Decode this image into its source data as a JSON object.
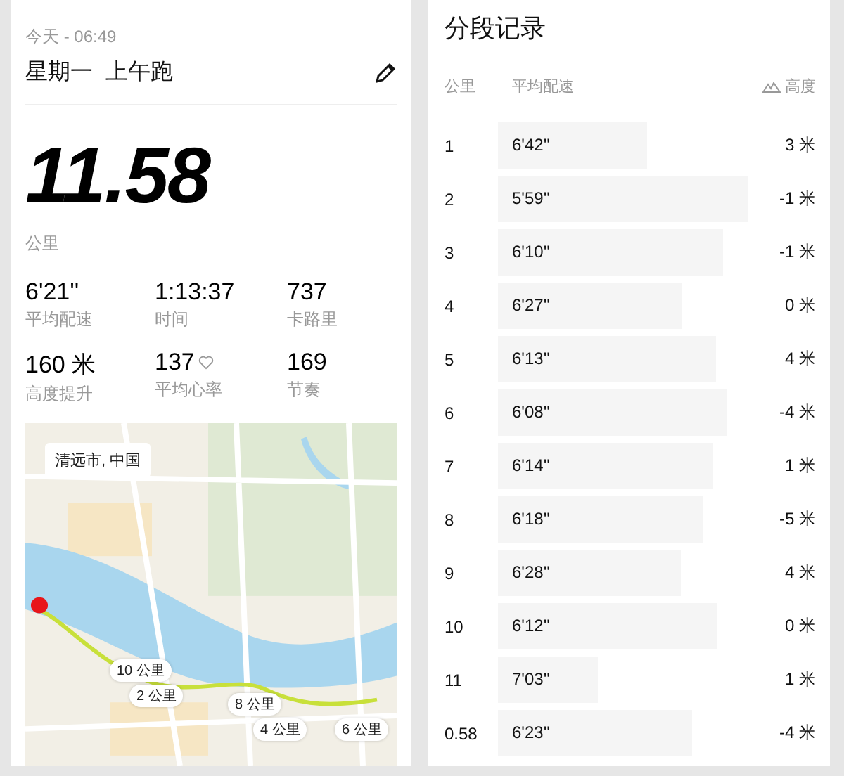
{
  "activity": {
    "date_time": "今天 - 06:49",
    "title": "星期一  上午跑",
    "distance": "11.58",
    "distance_unit": "公里",
    "stats": [
      {
        "kind": "plain",
        "value": "6'21''",
        "label": "平均配速"
      },
      {
        "kind": "plain",
        "value": "1:13:37",
        "label": "时间"
      },
      {
        "kind": "plain",
        "value": "737",
        "label": "卡路里"
      },
      {
        "kind": "plain",
        "value": "160 米",
        "label": "高度提升"
      },
      {
        "kind": "heart_rate",
        "value": "137",
        "label": "平均心率"
      },
      {
        "kind": "plain",
        "value": "169",
        "label": "节奏"
      }
    ],
    "map": {
      "location": "清远市, 中国",
      "markers": [
        "10 公里",
        "2 公里",
        "8 公里",
        "4 公里",
        "6 公里"
      ]
    }
  },
  "splits": {
    "title": "分段记录",
    "columns": [
      "公里",
      "平均配速",
      "高度"
    ],
    "rows": [
      {
        "km": "1",
        "pace": "6'42''",
        "elevation": "3 米"
      },
      {
        "km": "2",
        "pace": "5'59''",
        "elevation": "-1 米"
      },
      {
        "km": "3",
        "pace": "6'10''",
        "elevation": "-1 米"
      },
      {
        "km": "4",
        "pace": "6'27''",
        "elevation": "0 米"
      },
      {
        "km": "5",
        "pace": "6'13''",
        "elevation": "4 米"
      },
      {
        "km": "6",
        "pace": "6'08''",
        "elevation": "-4 米"
      },
      {
        "km": "7",
        "pace": "6'14''",
        "elevation": "1 米"
      },
      {
        "km": "8",
        "pace": "6'18''",
        "elevation": "-5 米"
      },
      {
        "km": "9",
        "pace": "6'28''",
        "elevation": "4 米"
      },
      {
        "km": "10",
        "pace": "6'12''",
        "elevation": "0 米"
      },
      {
        "km": "11",
        "pace": "7'03''",
        "elevation": "1 米"
      },
      {
        "km": "0.58",
        "pace": "6'23''",
        "elevation": "-4 米"
      }
    ]
  }
}
